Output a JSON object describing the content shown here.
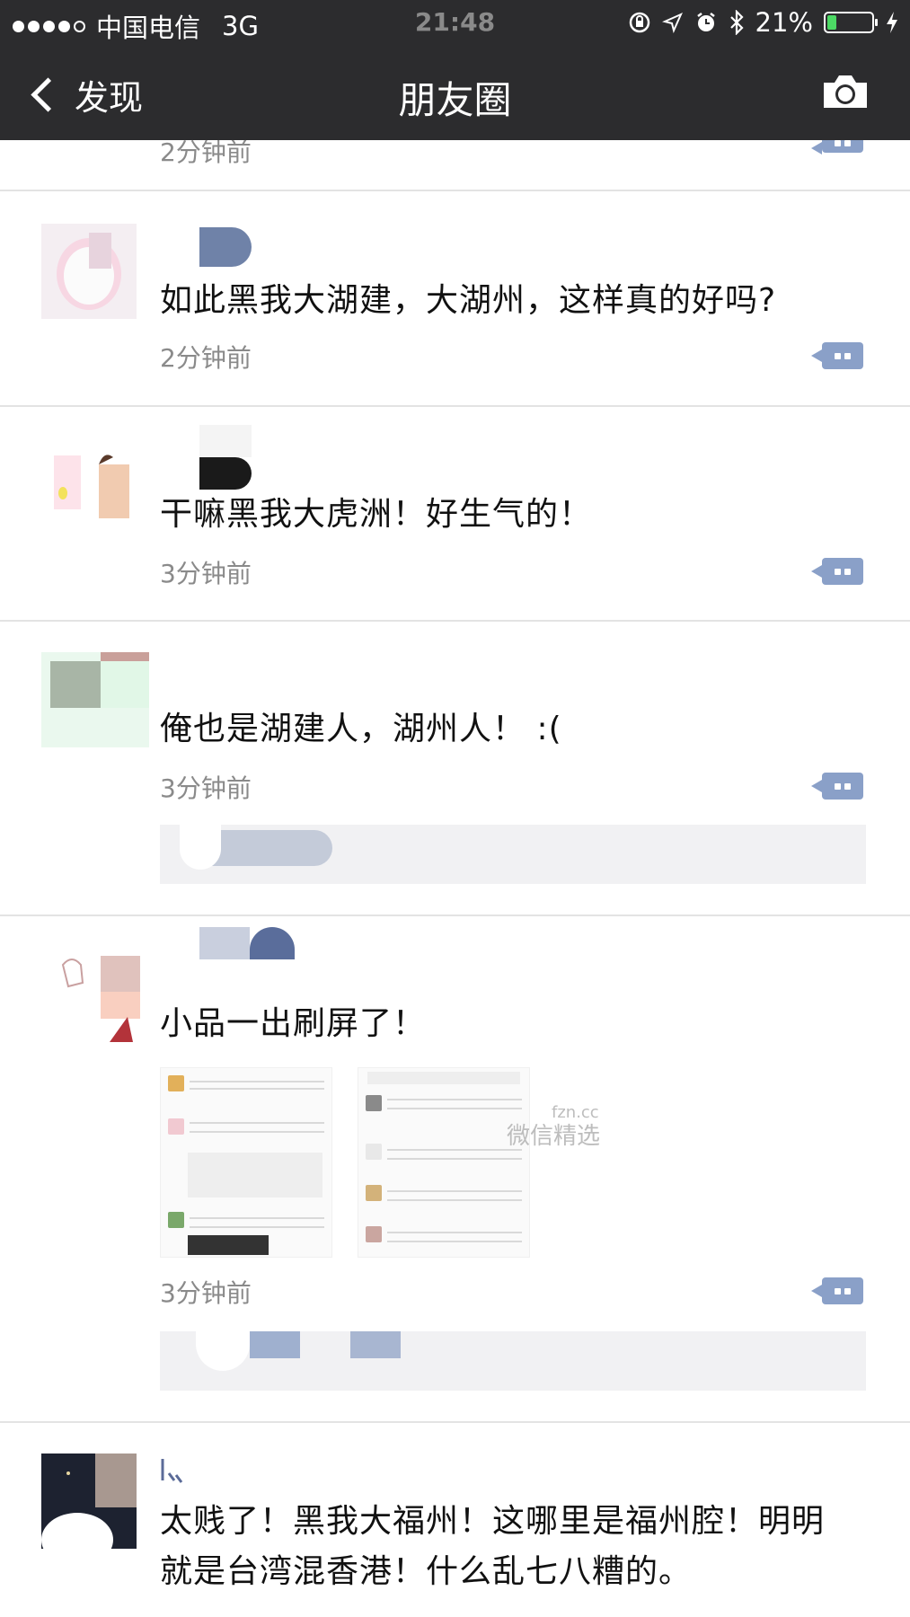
{
  "status_bar": {
    "carrier": "中国电信",
    "network": "3G",
    "time": "21:48",
    "battery": "21%",
    "battery_level": 0.21
  },
  "nav": {
    "back_label": "发现",
    "title": "朋友圈"
  },
  "feed": {
    "top_partial_time": "2分钟前",
    "posts": [
      {
        "content": "如此黑我大湖建，大湖州，这样真的好吗?",
        "time": "2分钟前"
      },
      {
        "content": "干嘛黑我大虎洲！好生气的！",
        "time": "3分钟前"
      },
      {
        "content": "俺也是湖建人，湖州人！ :(",
        "time": "3分钟前"
      },
      {
        "content": "小品一出刷屏了！",
        "time": "3分钟前"
      },
      {
        "content_line1": "太贱了！黑我大福州！这哪里是福州腔！明明",
        "content_line2": "就是台湾混香港！什么乱七八糟的。"
      }
    ]
  },
  "watermark": {
    "line1": "fzn.cc",
    "line2": "微信精选"
  },
  "colors": {
    "bar": "#2c2c2e",
    "link_blue": "#5b6b98",
    "comment_icon": "#8aa0c8",
    "battery_green": "#4cd964"
  }
}
